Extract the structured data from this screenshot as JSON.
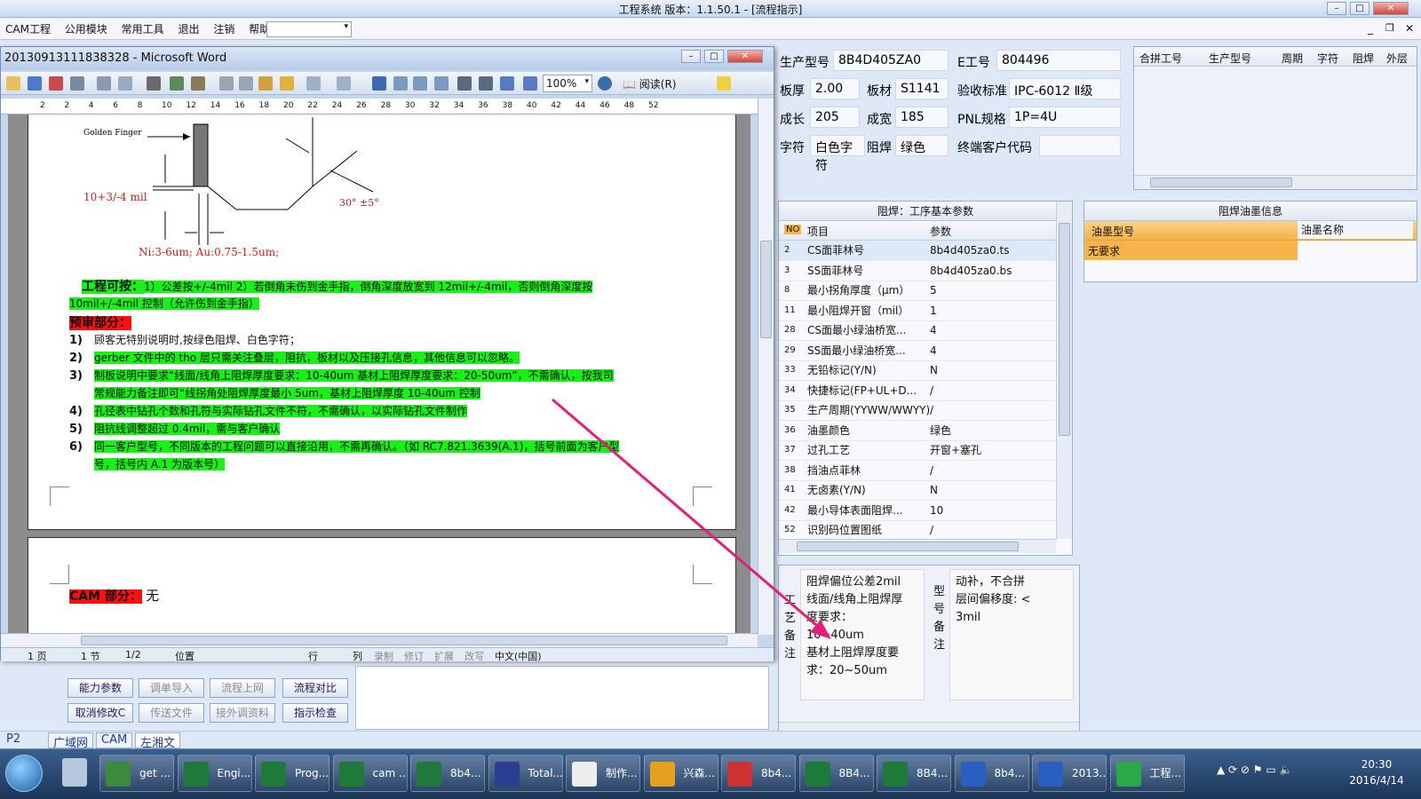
{
  "app": {
    "title": "工程系统   版本：1.1.50.1 - [流程指示]",
    "menu": [
      "CAM工程",
      "公用模块",
      "常用工具",
      "退出",
      "注销",
      "帮助"
    ]
  },
  "header_fields": {
    "model_label": "生产型号",
    "model": "8B4D405ZA0",
    "eno_label": "E工号",
    "eno": "804496",
    "thick_label": "板厚",
    "thick": "2.00",
    "mat_label": "板材",
    "mat": "S1141",
    "std_label": "验收标准",
    "std": "IPC-6012 Ⅱ级",
    "len_label": "成长",
    "len": "205",
    "wid_label": "成宽",
    "wid": "185",
    "pnl_label": "PNL规格",
    "pnl": "1P=4U",
    "char_label": "字符",
    "char": "白色字符",
    "sm_label": "阻焊",
    "sm": "绿色",
    "cust_label": "终端客户代码",
    "cust": ""
  },
  "combine_table": {
    "columns": [
      "合拼工号",
      "生产型号",
      "周期",
      "字符",
      "阻焊",
      "外层"
    ]
  },
  "params_panel": {
    "title": "阻焊：工序基本参数",
    "columns": [
      "NO",
      "项目",
      "参数"
    ],
    "rows": [
      {
        "no": "2",
        "item": "CS面菲林号",
        "val": "8b4d405za0.ts"
      },
      {
        "no": "3",
        "item": "SS面菲林号",
        "val": "8b4d405za0.bs"
      },
      {
        "no": "8",
        "item": "最小拐角厚度（μm）",
        "val": "5"
      },
      {
        "no": "11",
        "item": "最小阻焊开窗（mil）",
        "val": "1"
      },
      {
        "no": "28",
        "item": "CS面最小绿油桥宽...",
        "val": "4"
      },
      {
        "no": "29",
        "item": "SS面最小绿油桥宽...",
        "val": "4"
      },
      {
        "no": "33",
        "item": "无铅标记(Y/N)",
        "val": "N"
      },
      {
        "no": "34",
        "item": "快捷标记(FP+UL+D...",
        "val": "/"
      },
      {
        "no": "35",
        "item": "生产周期(YYWW/WWYY)",
        "val": "/"
      },
      {
        "no": "36",
        "item": "油墨颜色",
        "val": "绿色"
      },
      {
        "no": "37",
        "item": "过孔工艺",
        "val": "开窗+塞孔"
      },
      {
        "no": "38",
        "item": "挡油点菲林",
        "val": "/"
      },
      {
        "no": "41",
        "item": "无卤素(Y/N)",
        "val": "N"
      },
      {
        "no": "42",
        "item": "最小导体表面阻焊...",
        "val": "10"
      },
      {
        "no": "52",
        "item": "识别码位置图纸",
        "val": "/"
      }
    ]
  },
  "ink_panel": {
    "title": "阻焊油墨信息",
    "columns": [
      "油墨型号",
      "油墨名称"
    ],
    "rows": [
      {
        "model": "无要求",
        "name": ""
      }
    ]
  },
  "process_note": {
    "label": [
      "工",
      "艺",
      "备",
      "注"
    ],
    "lines": [
      "阻焊偏位公差2mil",
      "线面/线角上阻焊厚",
      "度要求：",
      "10~40um",
      "基材上阻焊厚度要",
      "求：20~50um"
    ]
  },
  "model_note": {
    "label": [
      "型",
      "号",
      "备",
      "注"
    ],
    "lines": [
      "动补，不合拼",
      "层间偏移度: <",
      "3mil"
    ]
  },
  "buttons": [
    {
      "label": "能力参数",
      "enabled": true
    },
    {
      "label": "调单导入",
      "enabled": false
    },
    {
      "label": "流程上网",
      "enabled": false
    },
    {
      "label": "流程对比",
      "enabled": true
    },
    {
      "label": "取消修改C",
      "enabled": true
    },
    {
      "label": "传送文件",
      "enabled": false
    },
    {
      "label": "接外调资料",
      "enabled": false
    },
    {
      "label": "指示检查",
      "enabled": true
    }
  ],
  "status_tabs": [
    "P2",
    "广域网",
    "CAM",
    "左湘文"
  ],
  "word": {
    "title": "20130913111838328 - Microsoft Word",
    "zoom": "100%",
    "read_btn": "阅读(R)",
    "ruler": [
      "2",
      "2",
      "4",
      "6",
      "8",
      "10",
      "12",
      "14",
      "16",
      "18",
      "20",
      "22",
      "24",
      "26",
      "28",
      "30",
      "32",
      "34",
      "36",
      "38",
      "40",
      "42",
      "44",
      "46",
      "48",
      "52"
    ],
    "figure": {
      "golden": "Golden Finger",
      "tol": "10+3/-4 mil",
      "angle": "30° ±5°",
      "plating": "Ni:3-6um; Au:0.75-1.5um;"
    },
    "eng_label": "工程可按：",
    "eng_text1": "1）公差按+/-4mil   2）若倒角未伤到金手指，倒角深度放宽到 12mil+/-4mil，否则倒角深度按",
    "eng_text2": "10mil+/-4mil 控制（允许伤到金手指）",
    "pre_label": "预审部分：",
    "items": [
      {
        "n": "1)",
        "t": "顾客无特别说明时,按绿色阻焊、白色字符；",
        "hl": false
      },
      {
        "n": "2)",
        "t": "gerber 文件中的 tho 层只需关注叠层，阻抗，板材以及压接孔信息，其他信息可以忽略。",
        "hl": true
      },
      {
        "n": "3)",
        "t": "制板说明中要求“线面/线角上阻焊厚度要求：10-40um 基材上阻焊厚度要求：20-50um”，不需确认，按我司",
        "hl": true
      },
      {
        "n": "",
        "t": "常规能力备注即可“线拐角处阻焊厚度最小 5um，基材上阻焊厚度 10-40um 控制",
        "hl": true
      },
      {
        "n": "4)",
        "t": "孔径表中钻孔个数和孔符与实际钻孔文件不符，不需确认，以实际钻孔文件制作",
        "hl": true
      },
      {
        "n": "5)",
        "t": "阻抗线调整超过 0.4mil，需与客户确认",
        "hl": true
      },
      {
        "n": "6)",
        "t": "同一客户型号，不同版本的工程问题可以直接沿用，不需再确认。（如 RC7.821.3639(A.1)，括号前面为客户型",
        "hl": true
      },
      {
        "n": "",
        "t": "号，括号内 A.1 为版本号）",
        "hl": true
      }
    ],
    "cam_label": "CAM 部分：",
    "cam_val": "无",
    "status": {
      "page": "1 页",
      "section": "1 节",
      "pages": "1/2",
      "pos": "位置",
      "row": "行",
      "col": "列",
      "rec": "录制",
      "rev": "修订",
      "ext": "扩展",
      "ovr": "改写",
      "lang": "中文(中国)"
    }
  },
  "taskbar": {
    "items": [
      {
        "label": "get ...",
        "color": "#3c8a3c"
      },
      {
        "label": "Engi...",
        "color": "#1d7a3a"
      },
      {
        "label": "Prog...",
        "color": "#1d7a3a"
      },
      {
        "label": "cam ...",
        "color": "#1d7a3a"
      },
      {
        "label": "8b4...",
        "color": "#1d7a3a"
      },
      {
        "label": "Total...",
        "color": "#2a3f8f"
      },
      {
        "label": "制作...",
        "color": "#eeeeee"
      },
      {
        "label": "兴森...",
        "color": "#e6a020"
      },
      {
        "label": "8b4...",
        "color": "#cc3333"
      },
      {
        "label": "8B4...",
        "color": "#1d7a3a"
      },
      {
        "label": "8B4...",
        "color": "#1d7a3a"
      },
      {
        "label": "8b4...",
        "color": "#2a5fbf"
      },
      {
        "label": "2013...",
        "color": "#2a5fbf"
      },
      {
        "label": "工程...",
        "color": "#2aa84a"
      }
    ],
    "time": "20:30",
    "date": "2016/4/14"
  },
  "colors": {
    "highlight": "#18f018",
    "red": "#ff1010",
    "arrow": "#e0207a",
    "row_select": "#f8b34a"
  }
}
